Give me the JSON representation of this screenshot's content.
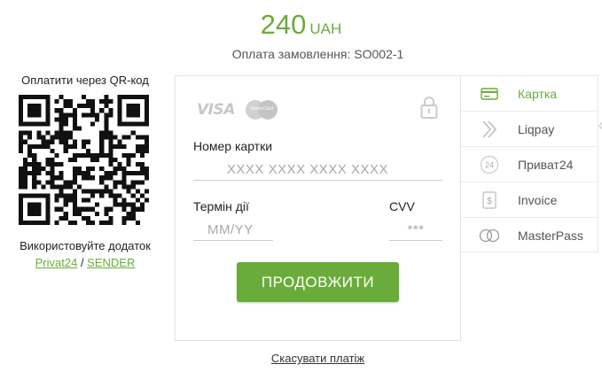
{
  "payment": {
    "amount": "240",
    "currency": "UAH",
    "order_text": "Оплата замовлення: SO002-1"
  },
  "qr": {
    "title": "Оплатити через QR-код",
    "hint": "Використовуйте додаток",
    "link_privat": "Privat24",
    "separator": " / ",
    "link_sender": "SENDER"
  },
  "card_form": {
    "card_number_label": "Номер картки",
    "card_number_placeholder": "XXXX XXXX XXXX XXXX",
    "expiry_label": "Термін дії",
    "expiry_placeholder": "MM/YY",
    "cvv_label": "CVV",
    "cvv_placeholder": "***",
    "submit_label": "ПРОДОВЖИТИ",
    "logos": {
      "visa": "VISA",
      "mastercard": "MasterCard"
    }
  },
  "methods": [
    {
      "label": "Картка",
      "icon": "card-icon",
      "active": true
    },
    {
      "label": "Liqpay",
      "icon": "liqpay-icon"
    },
    {
      "label": "Приват24",
      "icon": "privat24-icon",
      "icon_text": "24"
    },
    {
      "label": "Invoice",
      "icon": "invoice-icon",
      "icon_text": "$"
    },
    {
      "label": "MasterPass",
      "icon": "masterpass-icon"
    }
  ],
  "cancel_label": "Скасувати платіж",
  "colors": {
    "accent": "#6aac3a",
    "muted": "#c8c8c8",
    "border": "#e4e4e4"
  }
}
